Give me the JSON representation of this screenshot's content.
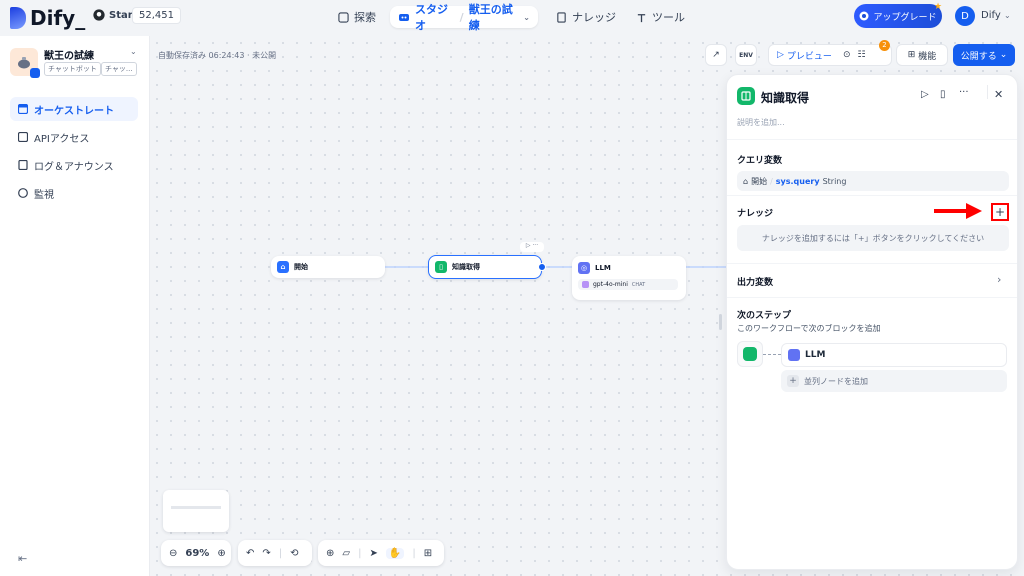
{
  "brand": {
    "name": "Dify_"
  },
  "github": {
    "star_label": "Star",
    "count": "52,451"
  },
  "nav": {
    "explore": "探索",
    "studio": "スタジオ",
    "app_name": "獣王の試練",
    "knowledge": "ナレッジ",
    "tools": "ツール"
  },
  "upgrade": {
    "label": "アップグレード"
  },
  "user": {
    "initial": "D",
    "name": "Dify"
  },
  "app": {
    "name": "獣王の試練",
    "tags": [
      "チャットボット",
      "チャッ..."
    ]
  },
  "sidebar": {
    "items": [
      {
        "label": "オーケストレート",
        "icon": "layout-icon"
      },
      {
        "label": "APIアクセス",
        "icon": "terminal-icon"
      },
      {
        "label": "ログ＆アナウンス",
        "icon": "log-icon"
      },
      {
        "label": "監視",
        "icon": "gauge-icon"
      }
    ]
  },
  "canvas": {
    "autosave": "自動保存済み 06:24:43 · 未公開",
    "nodes": {
      "start": "開始",
      "knowledge": "知識取得",
      "llm": "LLM",
      "llm_model": "gpt-4o-mini",
      "llm_mode": "CHAT"
    }
  },
  "toolbar": {
    "env": "ENV",
    "preview": "プレビュー",
    "badge": "2",
    "features": "機能",
    "publish": "公開する"
  },
  "panel": {
    "title": "知識取得",
    "description_placeholder": "説明を追加...",
    "query_var_label": "クエリ変数",
    "query_source": "開始",
    "query_var": "sys.query",
    "query_type": "String",
    "knowledge_label": "ナレッジ",
    "knowledge_empty": "ナレッジを追加するには「+」ボタンをクリックしてください",
    "output_label": "出力変数",
    "next_step_label": "次のステップ",
    "next_step_desc": "このワークフローで次のブロックを追加",
    "next_node": "LLM",
    "add_parallel": "並列ノードを追加"
  },
  "zoom": {
    "level": "69%"
  },
  "colors": {
    "accent": "#155eef",
    "knowledge_node": "#12b76a",
    "llm_node": "#6172f3",
    "arrow": "#f00"
  }
}
